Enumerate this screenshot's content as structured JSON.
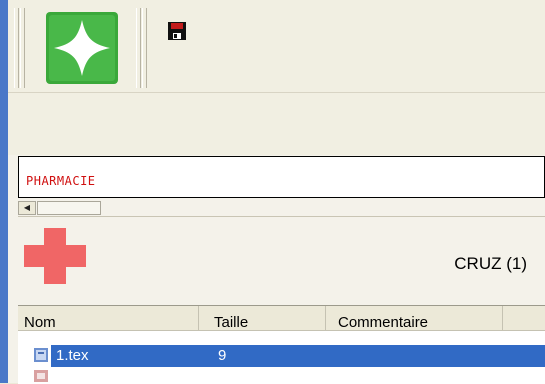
{
  "toolbar": {
    "main_button_icon": "green-compass-star-icon",
    "save_icon": "floppy-disk-icon"
  },
  "title_field": {
    "value": "PHARMACIE"
  },
  "section": {
    "icon": "red-cross-icon",
    "title": "CRUZ (1)"
  },
  "file_list": {
    "columns": [
      "Nom",
      "Taille",
      "Commentaire"
    ],
    "rows": [
      {
        "name": "1.tex",
        "size": "9",
        "comment": "",
        "selected": true
      }
    ]
  },
  "colors": {
    "accent_green": "#3aa83a",
    "title_text": "#d01010",
    "selection": "#316ac5",
    "cross": "#f06666"
  }
}
